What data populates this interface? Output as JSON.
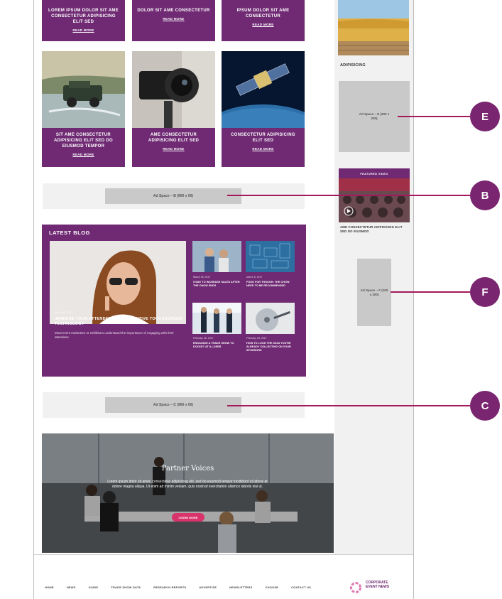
{
  "top_cards": [
    {
      "title": "LOREM IPSUM DOLOR SIT AME CONSECTETUR ADIPISICING ELIT SED",
      "read_more": "READ MORE"
    },
    {
      "title": "DOLOR SIT AME CONSECTETUR",
      "read_more": "READ MORE"
    },
    {
      "title": "IPSUM DOLOR SIT AME CONSECTETUR",
      "read_more": "READ MORE"
    }
  ],
  "image_cards": [
    {
      "title": "SIT AME CONSECTETUR ADIPISICING ELIT SED DO EIUSMOD TEMPOR",
      "read_more": "READ MORE",
      "image": "jeep-in-river"
    },
    {
      "title": "AME CONSECTETUR ADIPISICING ELIT SED",
      "read_more": "READ MORE",
      "image": "camera-lens"
    },
    {
      "title": "CONSECTETUR ADIPISICING ELIT SED",
      "read_more": "READ MORE",
      "image": "satellite-earth"
    }
  ],
  "ad_b": "Ad Space – B (960 x 00)",
  "ad_c": "Ad Space – C (960 x 00)",
  "blog": {
    "title": "LATEST BLOG",
    "main": {
      "date": "March 6, 2017",
      "title": "IMMERSE YOUR ATTENDEES WITH INTUITIVE TOUCHSCREEN TECHNOLOGY",
      "excerpt": "Most event marketers or exhibitors understand the importance of engaging with their attendees."
    },
    "posts": [
      {
        "date": "March 06, 2017",
        "title": "5 WAY TO INCREASE SALES AFTER THE CHOW ENDS"
      },
      {
        "date": "March 6, 2017",
        "title": "FOOD FOR THOUGH: THE CHOW NEED TO BE RECOMMENDED"
      },
      {
        "date": "February 28, 2017",
        "title": "ENGAGING A TRADE SHOW TO DOCKET AT A LOSER"
      },
      {
        "date": "February 23, 2017",
        "title": "HOW TO LOOK THE DATA YOU'RE ALREADY COLLECTING ON YOUR SPONSORS"
      }
    ]
  },
  "partner": {
    "title": "Partner Voices",
    "text": "Lorem ipsum dolor sit amet, consectetur adipisicing elit, sed do eiusmod tempor incididunt ut labore et dolore magna aliqua. Ut enim ad minim veniam, quis nostrud exercitation ullamco laboris nisi ut.",
    "button": "LEARN MORE"
  },
  "footer": {
    "nav": [
      "HOME",
      "NEWS",
      "GUIDE",
      "TRADE SHOW DATA",
      "RESEARCH REPORTS",
      "ADVERTISE",
      "NEWSLETTERS",
      "CHOOSE",
      "CONTACT US"
    ],
    "logo_text": "CORPORATE EVENT NEWS"
  },
  "sidebar": {
    "top_caption": "ADIPISICING",
    "ad_e": "Ad Space – E (200 x 200)",
    "video_label": "FEATURED VIDEO",
    "video_caption": "AME CONSECTETUR ADIPISICING ELIT SED DO EIUSMOD",
    "ad_f": "Ad Space – F (100 x 200)"
  },
  "callouts": [
    {
      "letter": "E"
    },
    {
      "letter": "B"
    },
    {
      "letter": "F"
    },
    {
      "letter": "C"
    }
  ],
  "colors": {
    "purple": "#6f2a73",
    "magenta_line": "#a4195c",
    "badge": "#7a2570",
    "button": "#d8336b"
  }
}
